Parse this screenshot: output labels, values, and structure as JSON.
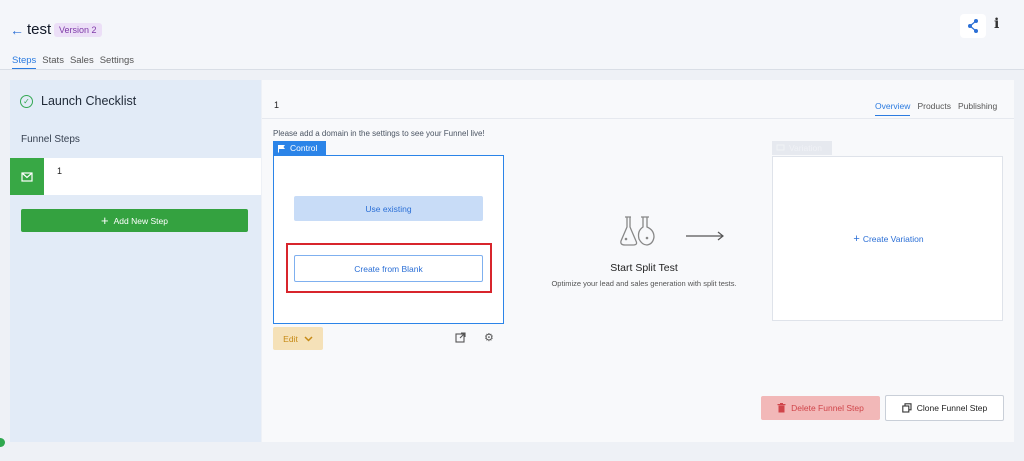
{
  "header": {
    "back_icon": "arrow-left-icon",
    "title": "test",
    "version_badge": "Version 2",
    "share_icon": "share-icon",
    "info_icon": "info-icon",
    "nav": [
      "Steps",
      "Stats",
      "Sales",
      "Settings"
    ],
    "active_nav": "Steps"
  },
  "sidebar": {
    "checklist_label": "Launch Checklist",
    "funnel_steps_heading": "Funnel Steps",
    "step_label": "1",
    "step_icon": "mail-icon",
    "add_step_label": "Add New Step"
  },
  "main": {
    "step_name": "1",
    "tabs": [
      "Overview",
      "Products",
      "Publishing"
    ],
    "active_tab": "Overview",
    "notice": "Please add a domain in the settings to see your Funnel live!",
    "control_label": "Control",
    "use_existing_label": "Use existing",
    "create_blank_label": "Create from Blank",
    "edit_label": "Edit",
    "split_title": "Start Split Test",
    "split_desc": "Optimize your lead and sales generation with split tests.",
    "variation_label": "Variation",
    "create_variation_label": "Create Variation",
    "delete_label": "Delete Funnel Step",
    "clone_label": "Clone Funnel Step"
  },
  "colors": {
    "accent_blue": "#2b84e8",
    "green": "#34a240",
    "highlight_red": "#d8252c",
    "edit_yellow": "#f5e1b8",
    "delete_red": "#f2b8b8"
  }
}
